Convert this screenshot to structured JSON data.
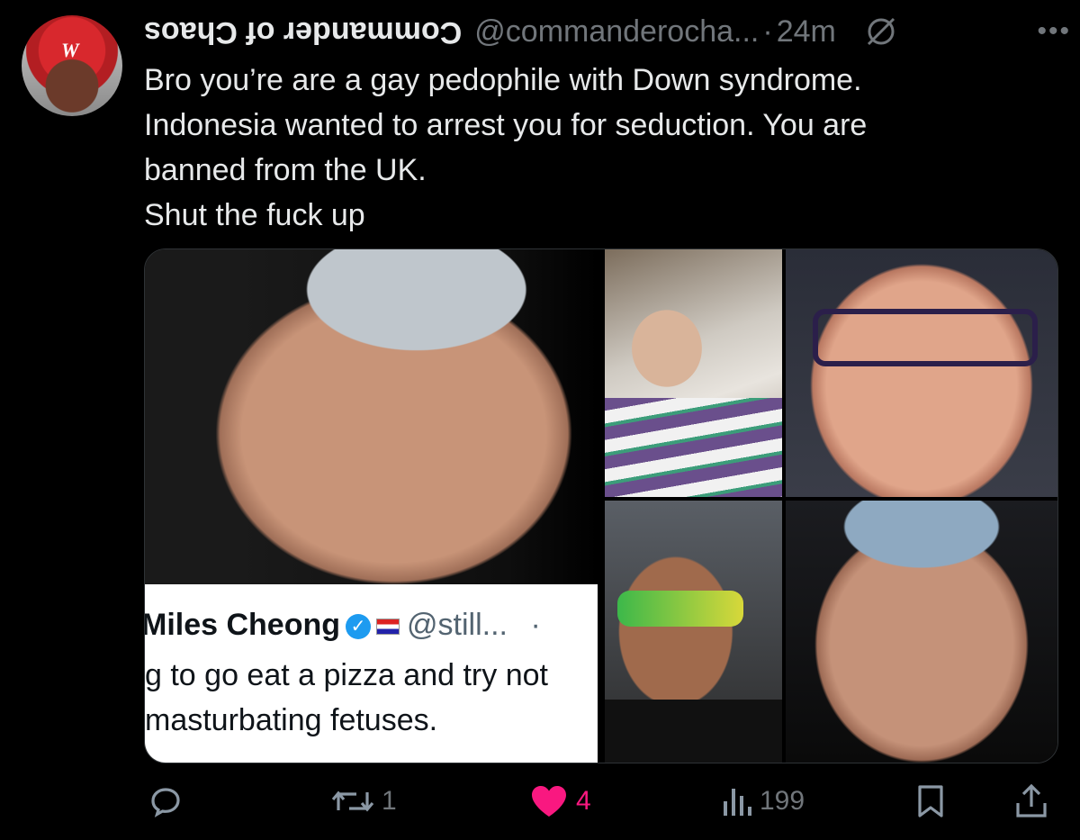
{
  "tweet": {
    "display_name": "Commander of Chaos",
    "handle": "@commanderocha...",
    "separator": "·",
    "time": "24m",
    "more_label": "•••",
    "text_lines": [
      "Bro you’re are a gay pedophile with Down syndrome.",
      "Indonesia wanted to arrest you for seduction. You are",
      "banned from the UK.",
      "Shut the fuck up"
    ]
  },
  "media": {
    "embedded_screenshot": {
      "name": "Miles Cheong",
      "handle": "@still...",
      "dot": "·",
      "line1": "g to go eat a pizza and try not",
      "line2": "masturbating fetuses."
    }
  },
  "actions": {
    "reply_count": "",
    "retweet_count": "1",
    "like_count": "4",
    "views_count": "199"
  },
  "colors": {
    "background": "#000000",
    "text_primary": "#e7e9ea",
    "text_secondary": "#71767b",
    "like_active": "#f91880",
    "verified": "#1d9bf0"
  },
  "icons": [
    "grok-icon",
    "more-icon",
    "reply-icon",
    "retweet-icon",
    "heart-icon",
    "views-icon",
    "bookmark-icon",
    "share-icon",
    "verified-icon",
    "flag-icon"
  ]
}
